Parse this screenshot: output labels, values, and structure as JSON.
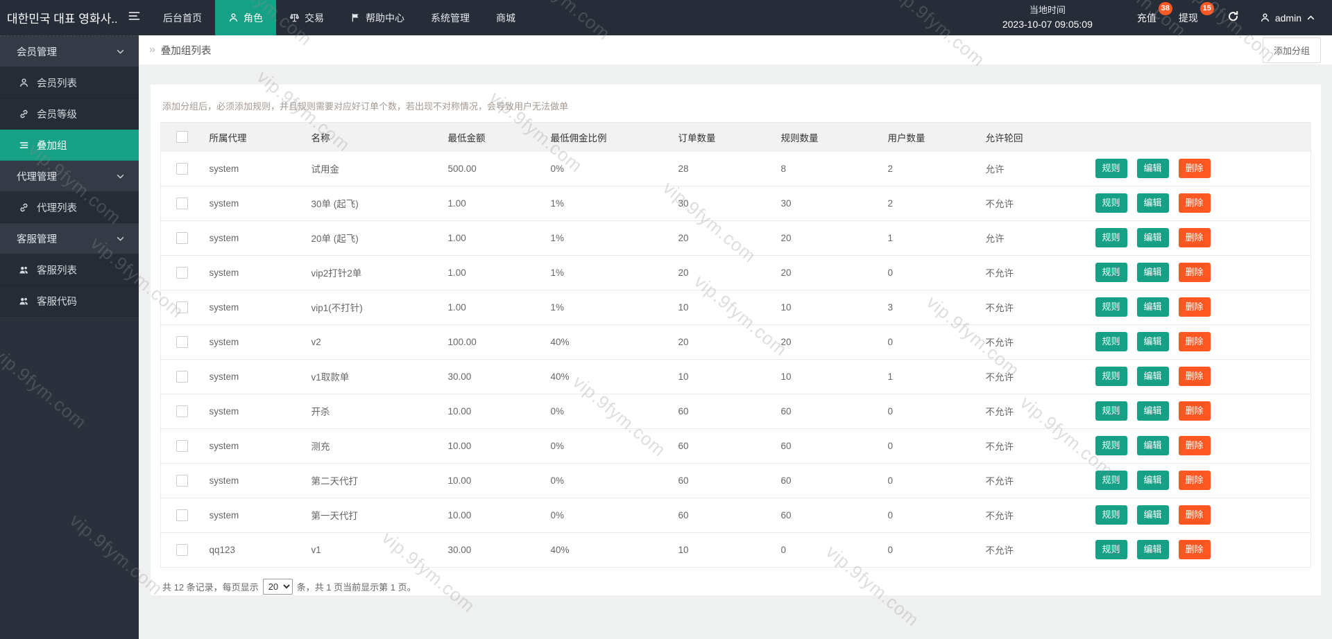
{
  "colors": {
    "accent": "#16a085",
    "danger": "#ff5722"
  },
  "watermark": {
    "text": "vip.9fym.com"
  },
  "topbar": {
    "brand": "대한민국 대표 영화사...",
    "menu": [
      {
        "key": "home",
        "label": "后台首页",
        "icon": null,
        "active": false
      },
      {
        "key": "role",
        "label": "角色",
        "icon": "person",
        "active": true
      },
      {
        "key": "trade",
        "label": "交易",
        "icon": "scale",
        "active": false
      },
      {
        "key": "help",
        "label": "帮助中心",
        "icon": "flag",
        "active": false
      },
      {
        "key": "system",
        "label": "系统管理",
        "icon": null,
        "active": false
      },
      {
        "key": "mall",
        "label": "商城",
        "icon": null,
        "active": false
      }
    ],
    "time": {
      "label": "当地时间",
      "value": "2023-10-07 09:05:09"
    },
    "recharge": {
      "label": "充值",
      "badge": "38"
    },
    "withdraw": {
      "label": "提现",
      "badge": "15"
    },
    "user": {
      "name": "admin"
    }
  },
  "sidebar": {
    "groups": [
      {
        "key": "member-mgmt",
        "label": "会员管理",
        "items": [
          {
            "key": "member-list",
            "label": "会员列表",
            "icon": "person",
            "active": false
          },
          {
            "key": "member-level",
            "label": "会员等级",
            "icon": "link",
            "active": false
          },
          {
            "key": "stack-group",
            "label": "叠加组",
            "icon": "list",
            "active": true
          }
        ]
      },
      {
        "key": "agent-mgmt",
        "label": "代理管理",
        "items": [
          {
            "key": "agent-list",
            "label": "代理列表",
            "icon": "link",
            "active": false
          }
        ]
      },
      {
        "key": "service-mgmt",
        "label": "客服管理",
        "items": [
          {
            "key": "service-list",
            "label": "客服列表",
            "icon": "users",
            "active": false
          },
          {
            "key": "service-code",
            "label": "客服代码",
            "icon": "users",
            "active": false
          }
        ]
      }
    ]
  },
  "page": {
    "breadcrumb": "叠加组列表",
    "add_button": "添加分组",
    "notice": "添加分组后，必须添加规则，并且规则需要对应好订单个数，若出现不对称情况，会导致用户无法做单"
  },
  "table": {
    "columns": [
      "所属代理",
      "名称",
      "最低金额",
      "最低佣金比例",
      "订单数量",
      "规则数量",
      "用户数量",
      "允许轮回"
    ],
    "actions": {
      "rule": "规则",
      "edit": "编辑",
      "delete": "删除"
    },
    "rows": [
      {
        "agent": "system",
        "name": "试用金",
        "min_amount": "500.00",
        "min_rate": "0%",
        "orders": "28",
        "rules": "8",
        "users": "2",
        "loop": "允许"
      },
      {
        "agent": "system",
        "name": "30单 (起飞)",
        "min_amount": "1.00",
        "min_rate": "1%",
        "orders": "30",
        "rules": "30",
        "users": "2",
        "loop": "不允许"
      },
      {
        "agent": "system",
        "name": "20单 (起飞)",
        "min_amount": "1.00",
        "min_rate": "1%",
        "orders": "20",
        "rules": "20",
        "users": "1",
        "loop": "允许"
      },
      {
        "agent": "system",
        "name": "vip2打针2单",
        "min_amount": "1.00",
        "min_rate": "1%",
        "orders": "20",
        "rules": "20",
        "users": "0",
        "loop": "不允许"
      },
      {
        "agent": "system",
        "name": "vip1(不打针)",
        "min_amount": "1.00",
        "min_rate": "1%",
        "orders": "10",
        "rules": "10",
        "users": "3",
        "loop": "不允许"
      },
      {
        "agent": "system",
        "name": "v2",
        "min_amount": "100.00",
        "min_rate": "40%",
        "orders": "20",
        "rules": "20",
        "users": "0",
        "loop": "不允许"
      },
      {
        "agent": "system",
        "name": "v1取款单",
        "min_amount": "30.00",
        "min_rate": "40%",
        "orders": "10",
        "rules": "10",
        "users": "1",
        "loop": "不允许"
      },
      {
        "agent": "system",
        "name": "开杀",
        "min_amount": "10.00",
        "min_rate": "0%",
        "orders": "60",
        "rules": "60",
        "users": "0",
        "loop": "不允许"
      },
      {
        "agent": "system",
        "name": "测充",
        "min_amount": "10.00",
        "min_rate": "0%",
        "orders": "60",
        "rules": "60",
        "users": "0",
        "loop": "不允许"
      },
      {
        "agent": "system",
        "name": "第二天代打",
        "min_amount": "10.00",
        "min_rate": "0%",
        "orders": "60",
        "rules": "60",
        "users": "0",
        "loop": "不允许"
      },
      {
        "agent": "system",
        "name": "第一天代打",
        "min_amount": "10.00",
        "min_rate": "0%",
        "orders": "60",
        "rules": "60",
        "users": "0",
        "loop": "不允许"
      },
      {
        "agent": "qq123",
        "name": "v1",
        "min_amount": "30.00",
        "min_rate": "40%",
        "orders": "10",
        "rules": "0",
        "users": "0",
        "loop": "不允许"
      }
    ]
  },
  "pagination": {
    "prefix": "共 12 条记录，每页显示",
    "page_size": "20",
    "suffix": "条，共 1 页当前显示第 1 页。"
  }
}
